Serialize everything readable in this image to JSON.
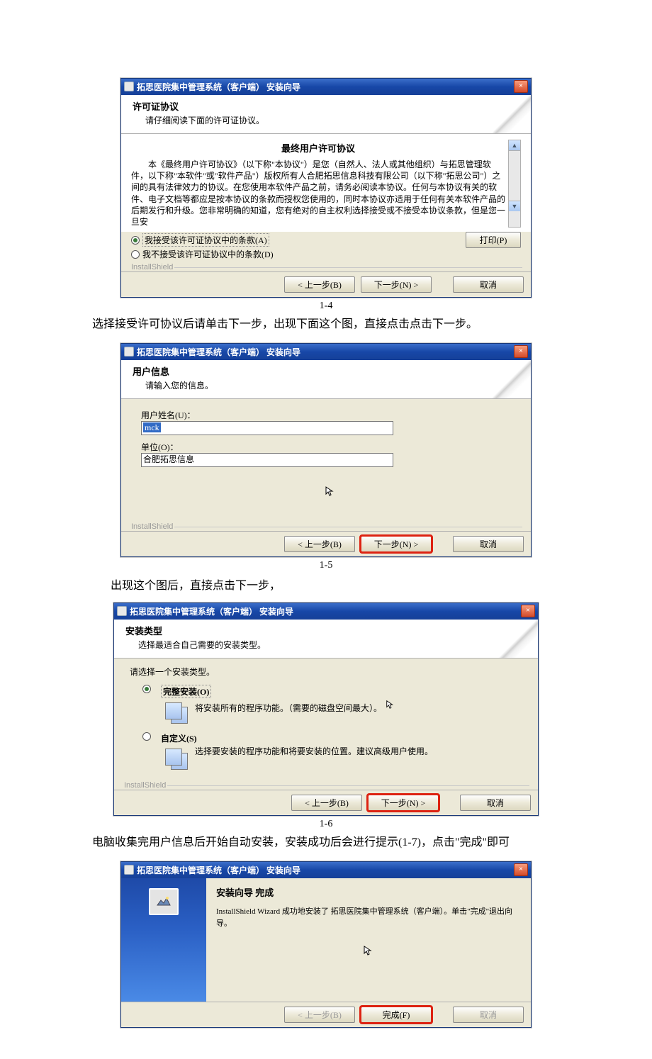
{
  "figures": {
    "f1": {
      "title": "拓思医院集中管理系统（客户端）  安装向导",
      "header_title": "许可证协议",
      "header_sub": "请仔细阅读下面的许可证协议。",
      "center_heading": "最终用户许可协议",
      "eula_text": "本《最终用户许可协议》（以下称\"本协议\"）是您（自然人、法人或其他组织）与拓思管理软件，以下称\"本软件\"或\"软件产品\"）版权所有人合肥拓思信息科技有限公司（以下称\"拓思公司\"）之间的具有法律效力的协议。在您使用本软件产品之前，请务必阅读本协议。任何与本协议有关的软件、电子文档等都应是按本协议的条款而授权您使用的，同时本协议亦适用于任何有关本软件产品的后期发行和升级。您非常明确的知道，您有绝对的自主权利选择接受或不接受本协议条款，但是您一旦安",
      "radio_accept": "我接受该许可证协议中的条款(A)",
      "radio_decline": "我不接受该许可证协议中的条款(D)",
      "installshield": "InstallShield",
      "btn_print": "打印(P)",
      "btn_back": "< 上一步(B)",
      "btn_next": "下一步(N) >",
      "btn_cancel": "取消",
      "caption": "1-4"
    },
    "p1": "选择接受许可协议后请单击下一步，出现下面这个图，直接点击点击下一步。",
    "f2": {
      "title": "拓思医院集中管理系统（客户端）  安装向导",
      "header_title": "用户信息",
      "header_sub": "请输入您的信息。",
      "label_user": "用户姓名(U)：",
      "value_user": "mck",
      "label_org": "单位(O)：",
      "value_org": "合肥拓思信息",
      "installshield": "InstallShield",
      "btn_back": "< 上一步(B)",
      "btn_next": "下一步(N) >",
      "btn_cancel": "取消",
      "caption": "1-5"
    },
    "p2": "出现这个图后，直接点击下一步，",
    "f3": {
      "title": "拓思医院集中管理系统（客户端）  安装向导",
      "header_title": "安装类型",
      "header_sub": "选择最适合自己需要的安装类型。",
      "prompt": "请选择一个安装类型。",
      "opt_full": "完整安装(O)",
      "opt_full_desc": "将安装所有的程序功能。（需要的磁盘空间最大）。",
      "opt_custom": "自定义(S)",
      "opt_custom_desc": "选择要安装的程序功能和将要安装的位置。建议高级用户使用。",
      "installshield": "InstallShield",
      "btn_back": "< 上一步(B)",
      "btn_next": "下一步(N) >",
      "btn_cancel": "取消",
      "caption": "1-6"
    },
    "p3": "电脑收集完用户信息后开始自动安装，安装成功后会进行提示(1-7)，点击\"完成\"即可",
    "f4": {
      "title": "拓思医院集中管理系统（客户端）  安装向导",
      "done_title": "安装向导 完成",
      "done_msg": "InstallShield Wizard 成功地安装了 拓思医院集中管理系统（客户端）。单击\"完成\"退出向导。",
      "btn_back": "< 上一步(B)",
      "btn_finish": "完成(F)",
      "btn_cancel": "取消"
    }
  }
}
